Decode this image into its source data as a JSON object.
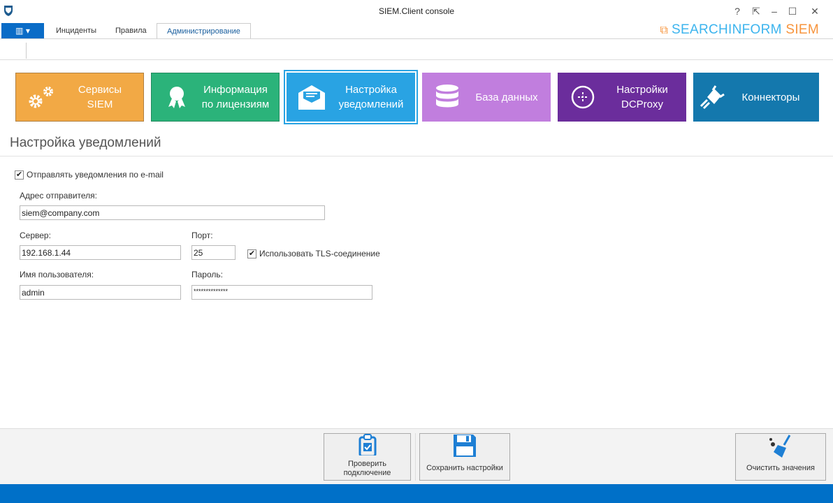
{
  "window": {
    "title": "SIEM.Client console",
    "help": "?",
    "pin": "⇱",
    "minimize": "–",
    "maximize": "☐",
    "close": "✕"
  },
  "tabs": [
    {
      "label": "Инциденты"
    },
    {
      "label": "Правила"
    },
    {
      "label": "Администрирование",
      "active": true
    }
  ],
  "logo": {
    "brand": "SEARCHINFORM",
    "product": "SIEM"
  },
  "tiles": [
    {
      "label1": "Сервисы",
      "label2": "SIEM",
      "color": "#F2A945"
    },
    {
      "label1": "Информация",
      "label2": "по лицензиям",
      "color": "#2BB37A"
    },
    {
      "label1": "Настройка",
      "label2": "уведомлений",
      "color": "#29A3E3",
      "selected": true
    },
    {
      "label1": "База данных",
      "label2": "",
      "color": "#C17EDE"
    },
    {
      "label1": "Настройки",
      "label2": "DCProxy",
      "color": "#6B2D9C"
    },
    {
      "label1": "Коннекторы",
      "label2": "",
      "color": "#1478AD"
    }
  ],
  "page": {
    "heading": "Настройка уведомлений"
  },
  "form": {
    "send_email": {
      "label": "Отправлять уведомления по e-mail",
      "checked": true
    },
    "sender_label": "Адрес отправителя:",
    "sender_value": "siem@company.com",
    "server_label": "Сервер:",
    "server_value": "192.168.1.44",
    "port_label": "Порт:",
    "port_value": "25",
    "tls": {
      "label": "Использовать TLS-соединение",
      "checked": true
    },
    "user_label": "Имя пользователя:",
    "user_value": "admin",
    "password_label": "Пароль:",
    "password_value": "**************"
  },
  "buttons": {
    "check": "Проверить подключение",
    "save": "Сохранить настройки",
    "clear": "Очистить значения"
  }
}
